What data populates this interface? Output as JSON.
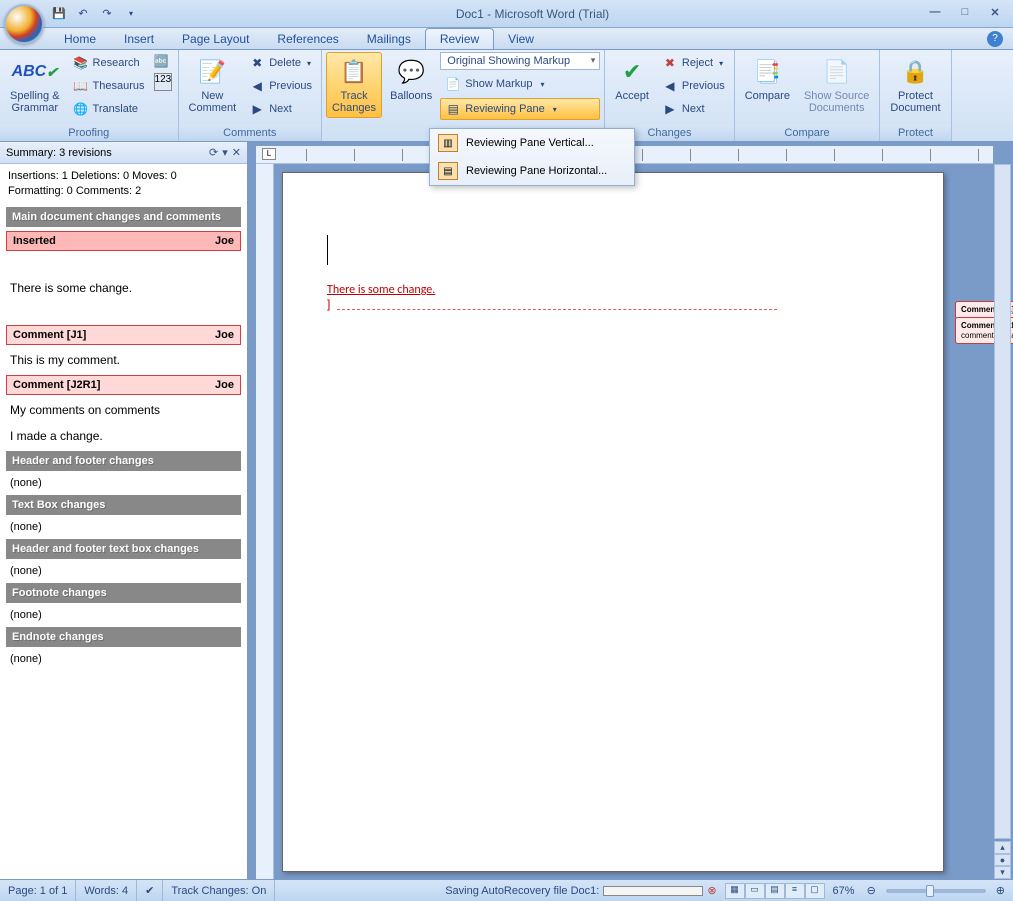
{
  "title": "Doc1 - Microsoft Word (Trial)",
  "tabs": [
    "Home",
    "Insert",
    "Page Layout",
    "References",
    "Mailings",
    "Review",
    "View"
  ],
  "activeTab": "Review",
  "ribbon": {
    "proofing": {
      "label": "Proofing",
      "spelling": "Spelling &\nGrammar",
      "research": "Research",
      "thesaurus": "Thesaurus",
      "translate": "Translate"
    },
    "comments": {
      "label": "Comments",
      "new": "New\nComment",
      "delete": "Delete",
      "previous": "Previous",
      "next": "Next"
    },
    "tracking": {
      "track": "Track\nChanges",
      "balloons": "Balloons",
      "display": "Original Showing Markup",
      "showMarkup": "Show Markup",
      "reviewingPane": "Reviewing Pane"
    },
    "changes": {
      "label": "Changes",
      "accept": "Accept",
      "reject": "Reject",
      "previous": "Previous",
      "next": "Next"
    },
    "compare": {
      "label": "Compare",
      "compare": "Compare",
      "showSource": "Show Source\nDocuments"
    },
    "protect": {
      "label": "Protect",
      "protect": "Protect\nDocument"
    }
  },
  "rpMenu": {
    "vertical": "Reviewing Pane Vertical...",
    "horizontal": "Reviewing Pane Horizontal..."
  },
  "reviewPane": {
    "summary": "Summary: 3 revisions",
    "stats1": "Insertions: 1  Deletions: 0  Moves: 0",
    "stats2": "Formatting: 0  Comments: 2",
    "mainTitle": "Main document changes and comments",
    "entry1": {
      "type": "Inserted",
      "author": "Joe",
      "body": "There is some change."
    },
    "entry2": {
      "type": "Comment [J1]",
      "author": "Joe",
      "body": "This is my comment."
    },
    "entry3": {
      "type": "Comment [J2R1]",
      "author": "Joe",
      "body1": "My comments on comments",
      "body2": "I made a change."
    },
    "sections": {
      "headerFooter": "Header and footer changes",
      "textBox": "Text Box changes",
      "hfTextBox": "Header and footer text box changes",
      "footnote": "Footnote changes",
      "endnote": "Endnote changes"
    },
    "none": "(none)"
  },
  "document": {
    "insertedText": "There is some change.",
    "comment1Label": "Comment [J1]:",
    "comment1Text": "This is my comment.",
    "comment2Label": "Comment [J2R1]:",
    "comment2Text": "My comments on comments I made a change."
  },
  "statusbar": {
    "page": "Page: 1 of 1",
    "words": "Words: 4",
    "trackChanges": "Track Changes: On",
    "saving": "Saving AutoRecovery file Doc1:",
    "zoom": "67%"
  }
}
